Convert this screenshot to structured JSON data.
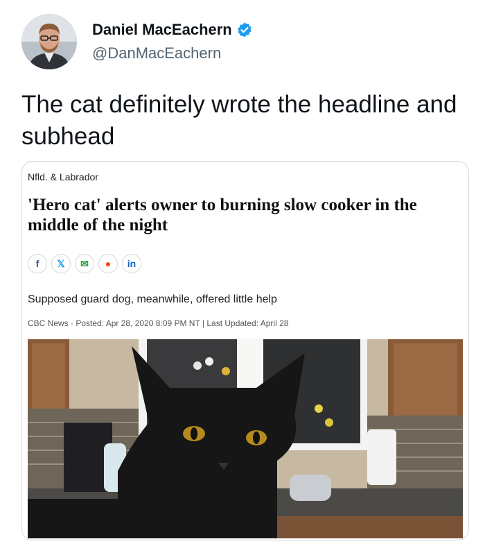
{
  "tweet": {
    "display_name": "Daniel MacEachern",
    "handle": "@DanMacEachern",
    "text": "The cat definitely wrote the headline and subhead",
    "avatar_icon": "profile-photo",
    "verified_icon": "verified-badge-icon"
  },
  "card": {
    "section": "Nfld. & Labrador",
    "headline": "'Hero cat' alerts owner to burning slow cooker in the middle of the night",
    "share_buttons": [
      {
        "label": "f",
        "icon": "facebook-icon",
        "color": "#3b5998"
      },
      {
        "label": "𝕏",
        "icon": "twitter-icon",
        "color": "#1da1f2"
      },
      {
        "label": "✉",
        "icon": "email-icon",
        "color": "#2e9e3e"
      },
      {
        "label": "●",
        "icon": "reddit-icon",
        "color": "#ff4500"
      },
      {
        "label": "in",
        "icon": "linkedin-icon",
        "color": "#0a66c2"
      }
    ],
    "subhead": "Supposed guard dog, meanwhile, offered little help",
    "meta": "CBC News · Posted: Apr 28, 2020 8:09 PM NT | Last Updated: April 28"
  },
  "colors": {
    "verified": "#1d9bf0",
    "handle": "#536471"
  }
}
